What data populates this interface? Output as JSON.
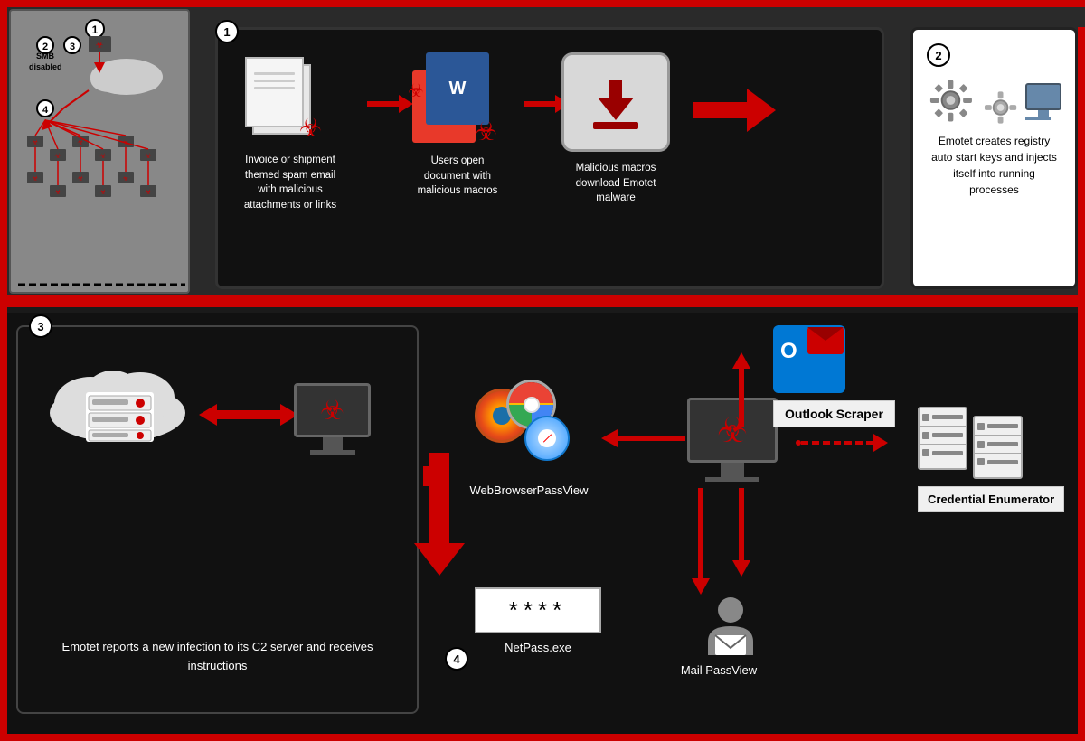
{
  "overview": {
    "label": "SMB disabled",
    "step_numbers": [
      "①",
      "②",
      "③",
      "④"
    ]
  },
  "step1": {
    "circle": "1",
    "label1": "Invoice or shipment themed spam email with malicious attachments or links",
    "label2": "Users open document with malicious macros",
    "label3": "Malicious macros download Emotet malware"
  },
  "step2": {
    "circle": "2",
    "label": "Emotet creates registry auto start keys and injects itself into running processes"
  },
  "step3": {
    "circle": "3",
    "label": "Emotet reports a new infection to its C2 server and receives instructions"
  },
  "step4": {
    "circle": "4",
    "tool1": "WebBrowserPassView",
    "tool2": "NetPass.exe",
    "tool3": "Outlook Scraper",
    "tool4": "Credential Enumerator",
    "tool5": "Mail PassView",
    "password_dots": "****"
  },
  "colors": {
    "red": "#cc0000",
    "dark_bg": "#1a1a1a",
    "white": "#ffffff",
    "gray": "#888888"
  }
}
